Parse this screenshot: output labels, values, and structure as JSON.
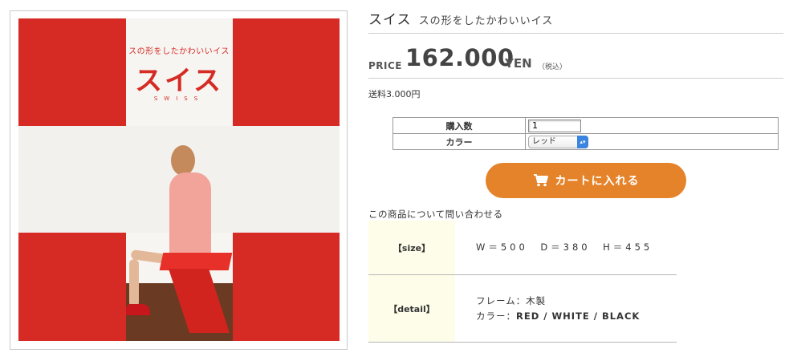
{
  "poster": {
    "subtitle": "スの形をしたかわいいイス",
    "title": "スイス",
    "english": "SWISS"
  },
  "product": {
    "name": "スイス",
    "catch": "スの形をしたかわいいイス",
    "price_label": "PRICE",
    "price": "162.000",
    "currency": "YEN",
    "tax": "（税込）",
    "shipping": "送料3.000円"
  },
  "options": {
    "quantity_label": "購入数",
    "quantity_value": "1",
    "color_label": "カラー",
    "color_selected": "レッド"
  },
  "cart_button": {
    "label": "カートに入れる",
    "icon": "cart-icon"
  },
  "inquiry": "この商品について問い合わせる",
  "specs": {
    "size_key": "【size】",
    "size_value": "W＝500　D＝380　H＝455",
    "detail_key": "【detail】",
    "detail_frame": "フレーム：木製",
    "detail_color_label": "カラー：",
    "detail_color_value": "RED / WHITE / BLACK"
  },
  "colors": {
    "accent_red": "#d52b24",
    "cart_orange": "#e5832a",
    "spec_bg": "#fefde9"
  }
}
